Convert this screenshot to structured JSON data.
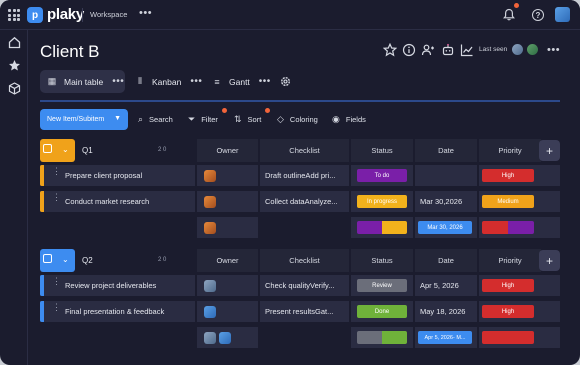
{
  "app": {
    "logo_text": "plaky",
    "workspace_label": "Workspace"
  },
  "header": {
    "title": "Client B",
    "last_seen_label": "Last seen"
  },
  "views": [
    {
      "label": "Main table",
      "active": true
    },
    {
      "label": "Kanban",
      "active": false
    },
    {
      "label": "Gantt",
      "active": false
    }
  ],
  "toolbar": {
    "new_item_label": "New Item/Subitem",
    "search_label": "Search",
    "filter_label": "Filter",
    "sort_label": "Sort",
    "coloring_label": "Coloring",
    "fields_label": "Fields"
  },
  "columns": {
    "owner": "Owner",
    "checklist": "Checklist",
    "status": "Status",
    "date": "Date",
    "priority": "Priority"
  },
  "groups": [
    {
      "name": "Q1",
      "meta": "2 0",
      "color": "#f0a21a",
      "items": [
        {
          "name": "Prepare client proposal",
          "checklist": "Draft outlineAdd pri...",
          "status": "To do",
          "status_color": "#7a1fa8",
          "date": "",
          "priority": "High",
          "priority_color": "#d42d2d"
        },
        {
          "name": "Conduct market research",
          "checklist": "Collect dataAnalyze...",
          "status": "In progress",
          "status_color": "#f2b21c",
          "date": "Mar 30,2026",
          "priority": "Medium",
          "priority_color": "#f0a21a"
        }
      ],
      "summary_date": "Mar 30, 2026"
    },
    {
      "name": "Q2",
      "meta": "2 0",
      "color": "#3d8cf0",
      "items": [
        {
          "name": "Review project deliverables",
          "checklist": "Check qualityVerify...",
          "status": "Review",
          "status_color": "#6b6e7a",
          "date": "Apr 5, 2026",
          "priority": "High",
          "priority_color": "#d42d2d"
        },
        {
          "name": "Final presentation & feedback",
          "checklist": "Present resultsGat...",
          "status": "Done",
          "status_color": "#6fb23a",
          "date": "May 18, 2026",
          "priority": "High",
          "priority_color": "#d42d2d"
        }
      ],
      "summary_date": "Apr 5, 2026- M..."
    }
  ],
  "icons": [
    "grid-icon",
    "bell-icon",
    "help-icon",
    "home-icon",
    "star-icon",
    "cube-icon",
    "star-outline-icon",
    "info-icon",
    "users-icon",
    "robot-icon",
    "chart-icon",
    "table-icon",
    "kanban-icon",
    "gantt-icon",
    "gear-icon",
    "search-icon",
    "filter-icon",
    "sort-icon",
    "coloring-icon",
    "eye-icon",
    "plus-icon"
  ]
}
